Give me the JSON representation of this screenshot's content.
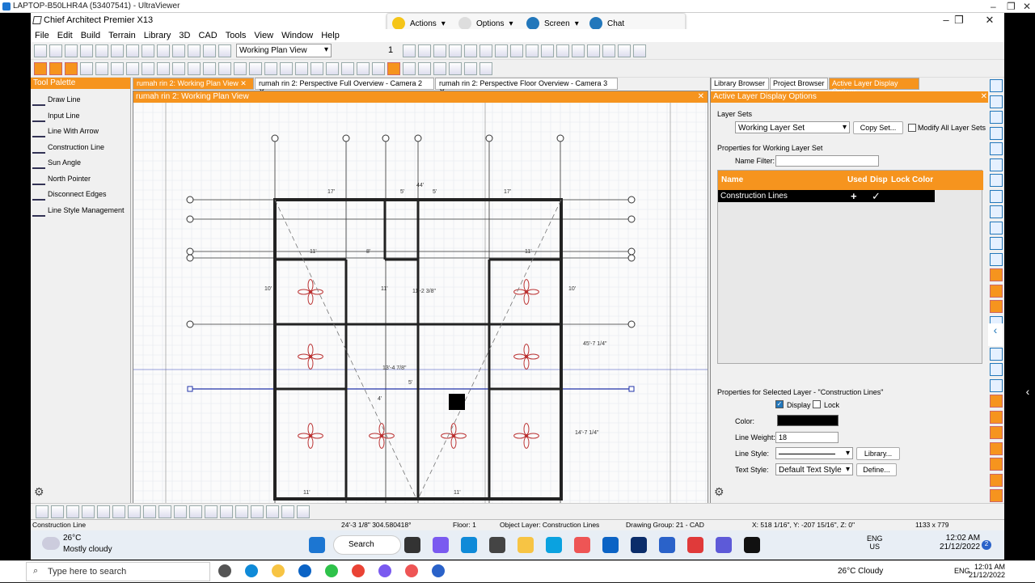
{
  "viewer": {
    "title": "LAPTOP-B50LHR4A (53407541) - UltraViewer",
    "tools": [
      {
        "label": "Actions",
        "icon": "bolt-icon"
      },
      {
        "label": "Options",
        "icon": "gear-icon"
      },
      {
        "label": "Screen",
        "icon": "camera-icon"
      },
      {
        "label": "Chat",
        "icon": "chat-icon"
      }
    ]
  },
  "app": {
    "title": "Chief Architect Premier X13",
    "menu": [
      "File",
      "Edit",
      "Build",
      "Terrain",
      "Library",
      "3D",
      "CAD",
      "Tools",
      "View",
      "Window",
      "Help"
    ],
    "layer_set_dropdown": "Working Plan View",
    "scale_value": "1"
  },
  "tool_palette": {
    "title": "Tool Palette",
    "items": [
      "Draw Line",
      "Input Line",
      "Line With Arrow",
      "Construction Line",
      "Sun Angle",
      "North Pointer",
      "Disconnect Edges",
      "Line Style Management"
    ]
  },
  "tabs": [
    {
      "label": "rumah rin 2:  Working Plan View",
      "active": true
    },
    {
      "label": "rumah rin 2:  Perspective Full Overview - Camera 2",
      "active": false
    },
    {
      "label": "rumah rin 2:  Perspective Floor Overview - Camera 3",
      "active": false
    }
  ],
  "plan_view": {
    "title": "rumah rin 2:  Working Plan View",
    "dims": [
      "44'",
      "17'",
      "5'",
      "5'",
      "17'",
      "11'",
      "8'",
      "11'",
      "11'",
      "10'",
      "11'",
      "5'",
      "4'",
      "11'",
      "13'-4 7/8\"",
      "11'-2 3/8\"",
      "45'-7 1/4\"",
      "14'-7 1/4\"",
      "11'"
    ]
  },
  "right_panel": {
    "tabs": [
      {
        "label": "Library Browser",
        "active": false
      },
      {
        "label": "Project Browser",
        "active": false
      },
      {
        "label": "Active Layer Display Options",
        "active": true
      }
    ],
    "title": "Active Layer Display Options",
    "layer_sets_label": "Layer Sets",
    "layer_set_value": "Working Layer Set",
    "copy_set": "Copy Set...",
    "modify_all": "Modify All Layer Sets",
    "properties_for": "Properties for  Working Layer Set",
    "name_filter_label": "Name Filter:",
    "name_filter_value": "",
    "columns": [
      "Name",
      "Used",
      "Disp",
      "Lock",
      "Color"
    ],
    "rows": [
      {
        "name": "Construction Lines",
        "used": "+",
        "disp": "✓"
      }
    ],
    "selected_layer_props": "Properties for Selected Layer - \"Construction Lines\"",
    "display_label": "Display",
    "display_checked": true,
    "lock_label": "Lock",
    "lock_checked": false,
    "color_label": "Color:",
    "color_value": "#000000",
    "line_weight_label": "Line Weight:",
    "line_weight_value": "18",
    "line_style_label": "Line Style:",
    "library_btn": "Library...",
    "text_style_label": "Text Style:",
    "text_style_value": "Default Text Style",
    "define_btn": "Define..."
  },
  "status_bar": {
    "tool": "Construction Line",
    "measure": "24'-3 1/8\" 304.580418°",
    "floor": "Floor: 1",
    "object_layer": "Object Layer: Construction Lines",
    "drawing_group": "Drawing Group: 21 - CAD",
    "coords": "X: 518 1/16\", Y: -207 15/16\", Z: 0\"",
    "size": "1133 x 779"
  },
  "remote_taskbar": {
    "weather_temp": "26°C",
    "weather_desc": "Mostly cloudy",
    "search": "Search",
    "lang1": "ENG",
    "lang2": "US",
    "time": "12:02 AM",
    "date": "21/12/2022",
    "badge": "2"
  },
  "local_taskbar": {
    "search_placeholder": "Type here to search",
    "weather": "26°C  Cloudy",
    "lang": "ENG",
    "time": "12:01 AM",
    "date": "21/12/2022"
  },
  "colors": {
    "accent": "#f6941e",
    "remote_blue": "#2277bb"
  }
}
